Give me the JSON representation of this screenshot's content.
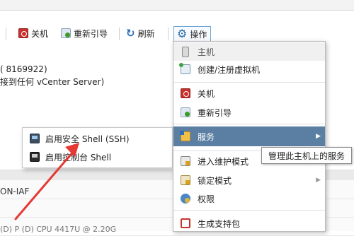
{
  "toolbar": {
    "shutdown_label": "关机",
    "reboot_label": "重新引导",
    "refresh_label": "刷新",
    "actions_label": "操作"
  },
  "host_info": {
    "line1": "( 8169922)",
    "line2": "接到任何 vCenter Server)"
  },
  "lower_panel": {
    "row_text": "ON-IAF",
    "bottom_text": "(D) P    (D) CPU   4417U @ 2.20G"
  },
  "actions_menu": {
    "header": "主机",
    "items": [
      {
        "label": "创建/注册虚拟机",
        "icon": "create-vm-icon"
      },
      {
        "label": "关机",
        "icon": "power-icon"
      },
      {
        "label": "重新引导",
        "icon": "reboot-icon"
      },
      {
        "label": "服务",
        "icon": "services-icon",
        "has_submenu": true,
        "active": true
      },
      {
        "label": "进入维护模式",
        "icon": "maintenance-icon"
      },
      {
        "label": "锁定模式",
        "icon": "lockdown-icon",
        "has_submenu": true
      },
      {
        "label": "权限",
        "icon": "permissions-icon"
      },
      {
        "label": "生成支持包",
        "icon": "support-bundle-icon"
      }
    ]
  },
  "services_submenu": {
    "items": [
      {
        "label": "启用安全 Shell (SSH)",
        "icon": "ssh-icon"
      },
      {
        "label": "启用控制台 Shell",
        "icon": "console-shell-icon"
      }
    ]
  },
  "tooltip": {
    "text": "管理此主机上的服务"
  },
  "colors": {
    "menu_active_bg": "#5b7fa3",
    "annotation_arrow": "#e53935",
    "toolbar_accent": "#2a6ca8"
  }
}
